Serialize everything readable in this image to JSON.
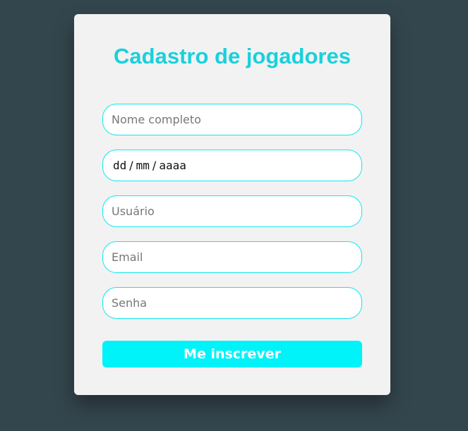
{
  "form": {
    "title": "Cadastro de jogadores",
    "fields": {
      "full_name_placeholder": "Nome completo",
      "birthdate": {
        "day": "dd",
        "month": "mm",
        "year": "aaaa",
        "separator": "/"
      },
      "username_placeholder": "Usuário",
      "email_placeholder": "Email",
      "password_placeholder": "Senha"
    },
    "submit_label": "Me inscrever"
  },
  "colors": {
    "background": "#34464d",
    "card": "#f2f2f2",
    "accent_title": "#1ad0dc",
    "accent_button": "#00f3f9",
    "input_border": "#12e6f0"
  }
}
